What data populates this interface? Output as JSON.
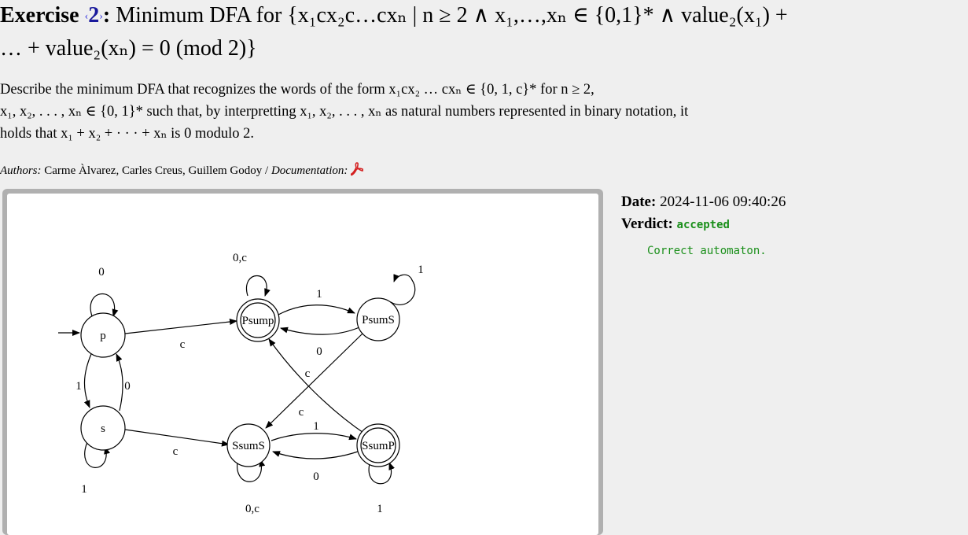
{
  "header": {
    "exercise_label": "Exercise",
    "exercise_number": "2",
    "title_text": "Minimum DFA for",
    "title_math_line1": "{x₁cx₂c…cxₙ | n ≥ 2 ∧ x₁,…,xₙ ∈ {0,1}* ∧ value₂(x₁) +",
    "title_math_line2": "… + value₂(xₙ) = 0   (mod 2)}"
  },
  "description": {
    "line1": "Describe the minimum DFA that recognizes the words of the form x₁cx₂ … cxₙ ∈ {0, 1, c}* for n ≥ 2,",
    "line2": "x₁, x₂, . . . , xₙ ∈ {0, 1}* such that, by interpretting x₁, x₂, . . . , xₙ as natural numbers represented in binary notation, it",
    "line3": "holds that x₁ + x₂ + · · · + xₙ is 0 modulo 2."
  },
  "authors": {
    "label": "Authors:",
    "names": "Carme Àlvarez, Carles Creus, Guillem Godoy",
    "separator": "/",
    "doc_label": "Documentation:",
    "doc_icon": "pdf-icon"
  },
  "submission": {
    "date_label": "Date:",
    "date_value": "2024-11-06 09:40:26",
    "verdict_label": "Verdict:",
    "verdict_value": "accepted",
    "message": "Correct automaton.",
    "verdict_color": "#1a8f1a"
  },
  "automaton": {
    "states": {
      "p": "p",
      "s": "s",
      "psump": "Psump",
      "psums": "PsumS",
      "ssums": "SsumS",
      "ssump": "SsumP"
    },
    "labels": {
      "p_loop": "0",
      "s_loop": "1",
      "psump_loop": "0,c",
      "psums_loop": "1",
      "ssums_loop": "0,c",
      "ssump_loop": "1",
      "p_to_psump": "c",
      "s_to_ssums": "c",
      "p_to_s": "1",
      "s_to_p": "0",
      "psump_to_psums": "1",
      "psums_to_psump": "0",
      "ssums_to_ssump": "1",
      "ssump_to_ssums": "0",
      "psums_to_ssums": "c",
      "ssump_to_psump": "c"
    }
  }
}
